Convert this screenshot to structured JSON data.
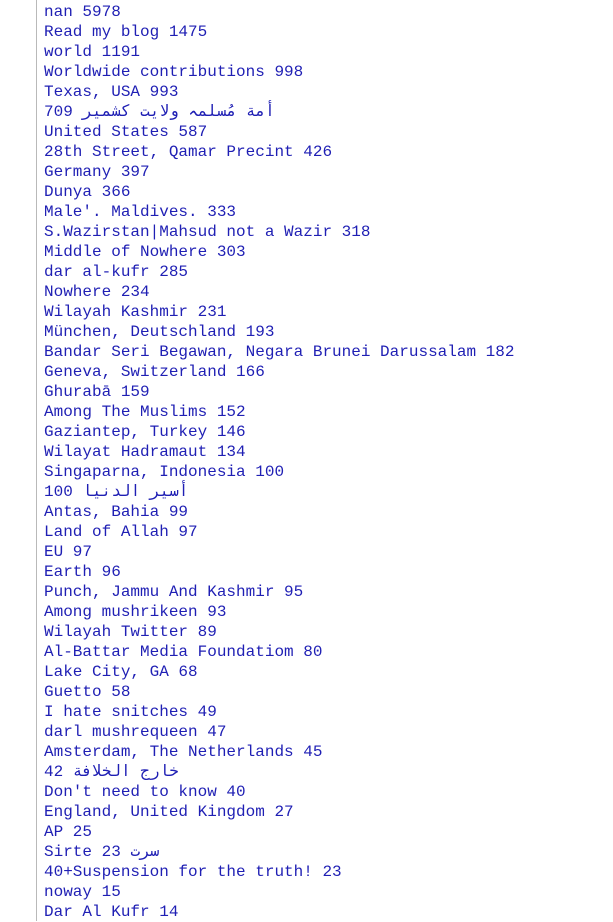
{
  "lines": [
    "nan 5978",
    "Read my blog 1475",
    "world 1191",
    "Worldwide contributions 998",
    "Texas, USA 993",
    "أمة مُسلمہ ولایت کشمیر 709",
    "United States 587",
    "28th Street, Qamar Precint 426",
    "Germany 397",
    "Dunya 366",
    "Male'. Maldives. 333",
    "S.Wazirstan|Mahsud not a Wazir 318",
    "Middle of Nowhere 303",
    "dar al-kufr 285",
    "Nowhere 234",
    "Wilayah Kashmir 231",
    "München, Deutschland 193",
    "Bandar Seri Begawan, Negara Brunei Darussalam 182",
    "Geneva, Switzerland 166",
    "Ghurabā 159",
    "Among The Muslims 152",
    "Gaziantep, Turkey 146",
    "Wilayat Hadramaut 134",
    "Singaparna, Indonesia 100",
    "أسير الدنيا 100",
    "Antas, Bahia 99",
    "Land of Allah 97",
    "EU 97",
    "Earth 96",
    "Punch, Jammu And Kashmir 95",
    "Among mushrikeen 93",
    "Wilayah Twitter 89",
    "Al-Battar Media Foundatiom 80",
    "Lake City, GA 68",
    "Guetto 58",
    "I hate snitches 49",
    "darl mushrequeen 47",
    "Amsterdam, The Netherlands 45",
    "خارج الخلافة 42",
    "Don't need to know 40",
    "England, United Kingdom 27",
    "AP 25",
    "سرت Sirte 23",
    "40+Suspension for the truth! 23",
    "noway 15",
    "Dar Al Kufr 14"
  ],
  "colors": {
    "text": "#1f1fb4",
    "gutter_border": "#b9b9b9",
    "background": "#ffffff"
  }
}
